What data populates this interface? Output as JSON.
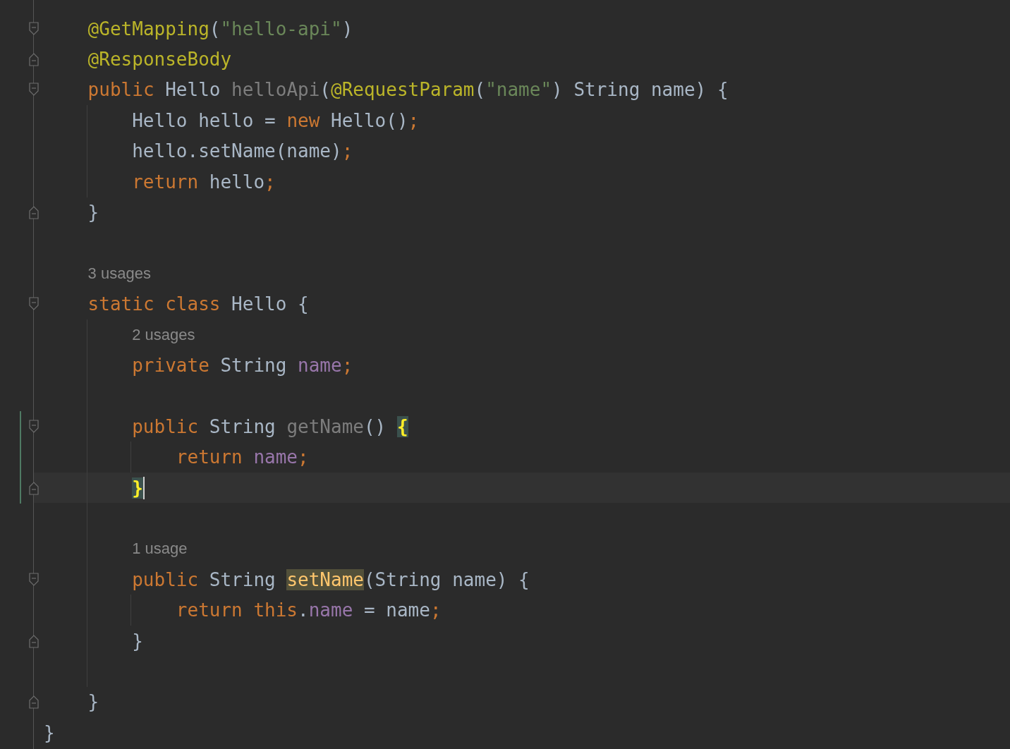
{
  "editor": {
    "lines": [
      {
        "kind": "code",
        "fold_start": true,
        "tokens": [
          {
            "text": "@GetMapping",
            "kind": "annotation"
          },
          {
            "text": "(",
            "kind": "plain"
          },
          {
            "text": "\"hello-api\"",
            "kind": "string"
          },
          {
            "text": ")",
            "kind": "plain"
          }
        ]
      },
      {
        "kind": "code",
        "fold_end": true,
        "tokens": [
          {
            "text": "@ResponseBody",
            "kind": "annotation"
          }
        ]
      },
      {
        "kind": "code",
        "fold_start": true,
        "tokens": [
          {
            "text": "public",
            "kind": "keyword"
          },
          {
            "text": " Hello ",
            "kind": "plain"
          },
          {
            "text": "helloApi",
            "kind": "unused"
          },
          {
            "text": "(",
            "kind": "plain"
          },
          {
            "text": "@RequestParam",
            "kind": "annotation"
          },
          {
            "text": "(",
            "kind": "plain"
          },
          {
            "text": "\"name\"",
            "kind": "string"
          },
          {
            "text": ") String name) {",
            "kind": "plain"
          }
        ],
        "children": [
          {
            "kind": "code",
            "tokens": [
              {
                "text": "Hello hello = ",
                "kind": "plain"
              },
              {
                "text": "new",
                "kind": "keyword"
              },
              {
                "text": " Hello()",
                "kind": "plain"
              },
              {
                "text": ";",
                "kind": "keyword"
              }
            ]
          },
          {
            "kind": "code",
            "tokens": [
              {
                "text": "hello.setName(name)",
                "kind": "plain"
              },
              {
                "text": ";",
                "kind": "keyword"
              }
            ]
          },
          {
            "kind": "code",
            "tokens": [
              {
                "text": "return",
                "kind": "keyword"
              },
              {
                "text": " hello",
                "kind": "plain"
              },
              {
                "text": ";",
                "kind": "keyword"
              }
            ]
          }
        ]
      },
      {
        "kind": "code",
        "fold_end": true,
        "tokens": [
          {
            "text": "}",
            "kind": "plain"
          }
        ]
      },
      {
        "kind": "blank"
      },
      {
        "kind": "inlay",
        "text": "3 usages"
      },
      {
        "kind": "code",
        "fold_start": true,
        "tokens": [
          {
            "text": "static class",
            "kind": "keyword"
          },
          {
            "text": " Hello {",
            "kind": "plain"
          }
        ],
        "children": [
          {
            "kind": "inlay",
            "text": "2 usages"
          },
          {
            "kind": "code",
            "tokens": [
              {
                "text": "private",
                "kind": "keyword"
              },
              {
                "text": " String ",
                "kind": "plain"
              },
              {
                "text": "name",
                "kind": "field"
              },
              {
                "text": ";",
                "kind": "keyword"
              }
            ]
          },
          {
            "kind": "blank"
          },
          {
            "kind": "code",
            "fold_start": true,
            "changed": true,
            "tokens": [
              {
                "text": "public",
                "kind": "keyword"
              },
              {
                "text": " String ",
                "kind": "plain"
              },
              {
                "text": "getName",
                "kind": "unused"
              },
              {
                "text": "() ",
                "kind": "plain"
              },
              {
                "text": "{",
                "kind": "brace"
              }
            ],
            "children": [
              {
                "kind": "code",
                "changed": true,
                "tokens": [
                  {
                    "text": "return ",
                    "kind": "keyword"
                  },
                  {
                    "text": "name",
                    "kind": "field"
                  },
                  {
                    "text": ";",
                    "kind": "keyword"
                  }
                ]
              }
            ]
          },
          {
            "kind": "code",
            "fold_end": true,
            "changed": true,
            "current": true,
            "caret": true,
            "tokens": [
              {
                "text": "}",
                "kind": "brace"
              }
            ]
          },
          {
            "kind": "blank"
          },
          {
            "kind": "inlay",
            "text": "1 usage"
          },
          {
            "kind": "code",
            "fold_start": true,
            "tokens": [
              {
                "text": "public",
                "kind": "keyword"
              },
              {
                "text": " String ",
                "kind": "plain"
              },
              {
                "text": "setName",
                "kind": "highlight"
              },
              {
                "text": "(String name) {",
                "kind": "plain"
              }
            ],
            "children": [
              {
                "kind": "code",
                "tokens": [
                  {
                    "text": "return this",
                    "kind": "keyword"
                  },
                  {
                    "text": ".",
                    "kind": "plain"
                  },
                  {
                    "text": "name",
                    "kind": "field"
                  },
                  {
                    "text": " = name",
                    "kind": "plain"
                  },
                  {
                    "text": ";",
                    "kind": "keyword"
                  }
                ]
              }
            ]
          },
          {
            "kind": "code",
            "fold_end": true,
            "tokens": [
              {
                "text": "}",
                "kind": "plain"
              }
            ]
          },
          {
            "kind": "blank"
          }
        ]
      },
      {
        "kind": "code",
        "fold_end": true,
        "tokens": [
          {
            "text": "}",
            "kind": "plain"
          }
        ]
      }
    ],
    "last_line": {
      "kind": "code",
      "tokens": [
        {
          "text": "}",
          "kind": "plain"
        }
      ]
    }
  }
}
